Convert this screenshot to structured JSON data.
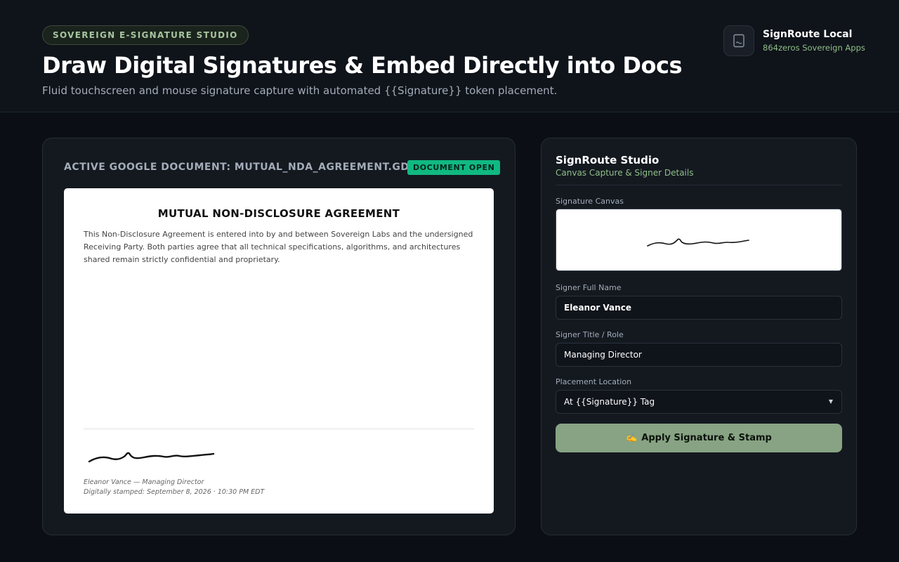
{
  "header": {
    "pill": "SOVEREIGN E-SIGNATURE STUDIO",
    "title": "Draw Digital Signatures & Embed Directly into Docs",
    "subtitle": "Fluid touchscreen and mouse signature capture with automated {{Signature}} token placement."
  },
  "brand": {
    "name": "SignRoute Local",
    "tagline": "864zeros Sovereign Apps",
    "icon": "document-icon"
  },
  "document": {
    "heading": "ACTIVE GOOGLE DOCUMENT: MUTUAL_NDA_AGREEMENT.GDOC",
    "status_badge": "DOCUMENT OPEN",
    "paper": {
      "title": "MUTUAL NON-DISCLOSURE AGREEMENT",
      "body": "This Non-Disclosure Agreement is entered into by and between Sovereign Labs and the undersigned Receiving Party. Both parties agree that all technical specifications, algorithms, and architectures shared remain strictly confidential and proprietary.",
      "signer_line": "Eleanor Vance — Managing Director",
      "stamp_line": "Digitally stamped: September 8, 2026 · 10:30 PM EDT"
    }
  },
  "studio": {
    "title": "SignRoute Studio",
    "subtitle": "Canvas Capture & Signer Details",
    "canvas_label": "Signature Canvas",
    "name_label": "Signer Full Name",
    "name_value": "Eleanor Vance",
    "role_label": "Signer Title / Role",
    "role_value": "Managing Director",
    "placement_label": "Placement Location",
    "placement_value": "At {{Signature}} Tag",
    "apply_icon": "✍️",
    "apply_label": "Apply Signature & Stamp"
  },
  "colors": {
    "accent_green": "#87a383",
    "badge_green": "#10b981",
    "panel_bg": "#141920",
    "page_bg": "#0b0f15"
  }
}
